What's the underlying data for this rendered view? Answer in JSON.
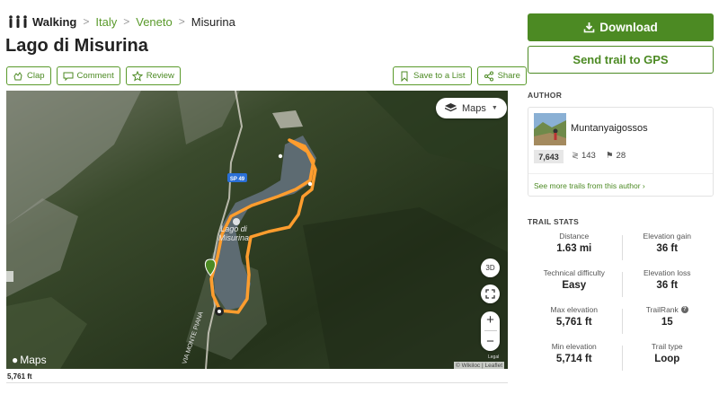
{
  "breadcrumb": {
    "activity": "Walking",
    "items": [
      "Italy",
      "Veneto"
    ],
    "current": "Misurina",
    "separator": ">"
  },
  "title": "Lago di Misurina",
  "actions": {
    "clap": "Clap",
    "comment": "Comment",
    "review": "Review",
    "save_to_list": "Save to a List",
    "share": "Share"
  },
  "map": {
    "layers_label": "Maps",
    "btn_3d": "3D",
    "zoom_in": "+",
    "zoom_out": "−",
    "road_sign": "SP 49",
    "lake_label_1": "Lago di",
    "lake_label_2": "Misurina",
    "road_label": "VIA MONTE PIANA",
    "provider_logo": "Maps",
    "attribution": "© Wikiloc | Leaflet",
    "legal": "Legal",
    "route_color": "#ff9d2e",
    "start_marker_color": "#4c8a23"
  },
  "elevation_label": "5,761 ft",
  "download_label": "Download",
  "send_gps_label": "Send trail to GPS",
  "author": {
    "heading": "AUTHOR",
    "name": "Muntanyaigossos",
    "points": "7,643",
    "followers": "143",
    "trails": "28",
    "see_more": "See more trails from this author ›"
  },
  "trail_stats": {
    "heading": "TRAIL STATS",
    "distance_label": "Distance",
    "distance_value": "1.63 mi",
    "elev_gain_label": "Elevation gain",
    "elev_gain_value": "36 ft",
    "tech_label": "Technical difficulty",
    "tech_value": "Easy",
    "elev_loss_label": "Elevation loss",
    "elev_loss_value": "36 ft",
    "max_elev_label": "Max elevation",
    "max_elev_value": "5,761 ft",
    "trailrank_label": "TrailRank",
    "trailrank_value": "15",
    "min_elev_label": "Min elevation",
    "min_elev_value": "5,714 ft",
    "trail_type_label": "Trail type",
    "trail_type_value": "Loop"
  },
  "colors": {
    "brand_green": "#4c8a23",
    "link_green": "#5a9a2b"
  }
}
